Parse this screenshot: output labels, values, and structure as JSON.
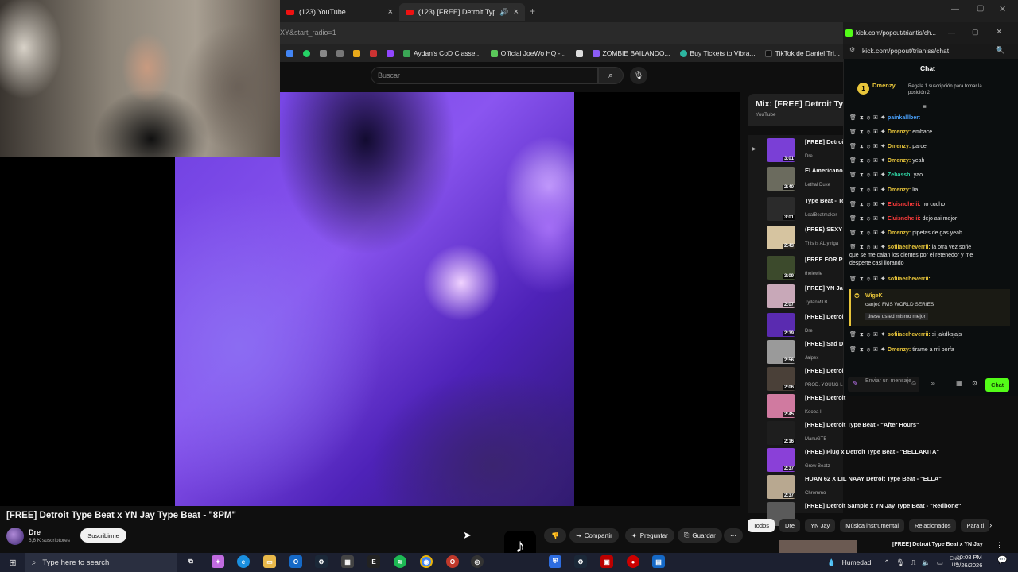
{
  "browser": {
    "tabs": [
      {
        "label": "(123) YouTube"
      },
      {
        "label": "(123) [FREE] Detroit Type Be"
      }
    ],
    "url_fragment": "XY&start_radio=1",
    "bookmarks": [
      {
        "label": "Aydan's CoD Classe...",
        "color": "#3aa655"
      },
      {
        "label": "Official JoeWo HQ -...",
        "color": "#5ac85a"
      },
      {
        "label": "ZOMBIE BAILANDO...",
        "color": "#8b5cf6"
      },
      {
        "label": "Buy Tickets to Vibra...",
        "color": "#2cb5a0"
      },
      {
        "label": "TikTok de Daniel Tri...",
        "color": "#111111"
      }
    ]
  },
  "youtube": {
    "search_placeholder": "Buscar",
    "video_title": "[FREE] Detroit Type Beat x YN Jay Type Beat - \"8PM\"",
    "channel_name": "Dre",
    "channel_subs": "6,6 K suscriptores",
    "subscribe_label": "Suscribirme",
    "actions": {
      "share": "Compartir",
      "ask": "Preguntar",
      "save": "Guardar"
    },
    "playlist": {
      "title": "Mix: [FREE] Detroit Type",
      "source": "YouTube",
      "items": [
        {
          "title": "[FREE] Detroit",
          "channel": "Dre",
          "duration": "3:01",
          "color": "#7a3fd6"
        },
        {
          "title": "El Americano x Trap Instrum",
          "channel": "Lethal Duke",
          "duration": "2:40",
          "color": "#6b6b5e"
        },
        {
          "title": "Type Beat - To 2025",
          "channel": "LealBeatmaker",
          "duration": "3:01",
          "color": "#2b2b2b"
        },
        {
          "title": "(FREE) SEXY D YOU\" - KIDWI",
          "channel": "This is AL y riga",
          "duration": "2:43",
          "color": "#d6c4a0"
        },
        {
          "title": "[FREE FOR PR BEAT 2026 –",
          "channel": "thelewie",
          "duration": "3:09",
          "color": "#3c4a2c"
        },
        {
          "title": "[FREE] YN Jay",
          "channel": "TyllanMTB",
          "duration": "2:07",
          "color": "#c8a8b8"
        },
        {
          "title": "[FREE] Detroit",
          "channel": "Dre",
          "duration": "2:39",
          "color": "#5a2bb0"
        },
        {
          "title": "[FREE] Sad De",
          "channel": "Jalpex",
          "duration": "2:56",
          "color": "#9a9a9a"
        },
        {
          "title": "[FREE] Detroit",
          "channel": "PROD. YOUNG L",
          "duration": "2:06",
          "color": "#4a4038"
        },
        {
          "title": "[FREE] Detroit",
          "channel": "Kooba II",
          "duration": "2:45",
          "color": "#d07aa0"
        },
        {
          "title": "[FREE] Detroit Type Beat - \"After Hours\"",
          "channel": "ManuGTB",
          "duration": "2:16",
          "color": "#1e1e1e"
        },
        {
          "title": "(FREE) Plug x Detroit Type Beat - \"BELLAKITA\"",
          "channel": "Grow Beatz",
          "duration": "2:37",
          "color": "#8a40d8"
        },
        {
          "title": "HUAN 62 X LIL NAAY Detroit Type Beat - \"ELLA\"",
          "channel": "Chrommo",
          "duration": "2:37",
          "color": "#b8a890"
        },
        {
          "title": "[FREE] Detroit Sample x YN Jay Type Beat - \"Redbone\"",
          "channel": "",
          "duration": "",
          "color": "#5a5a5a"
        }
      ]
    },
    "chips": [
      "Todos",
      "Dre",
      "YN Jay",
      "Música instrumental",
      "Relacionados",
      "Para ti"
    ],
    "next_up": "[FREE] Detroit Type Beat x YN Jay"
  },
  "kick": {
    "title": "kick.com/popout/triantis/ch...",
    "url": "kick.com/popout/trianiss/chat",
    "header": "Chat",
    "pinned_user": "Dmenzy",
    "pinned_text": "Regala 1 suscripción para tomar la posición 2",
    "messages": [
      {
        "user": "painkalllber",
        "text": "",
        "color": "#4aa3ff"
      },
      {
        "user": "Dmenzy",
        "text": "embace",
        "color": "#e8c53a"
      },
      {
        "user": "Dmenzy",
        "text": "parce",
        "color": "#e8c53a"
      },
      {
        "user": "Dmenzy",
        "text": "yeah",
        "color": "#e8c53a"
      },
      {
        "user": "Zebassh",
        "text": "yao",
        "color": "#2fd3a3"
      },
      {
        "user": "Dmenzy",
        "text": "lia",
        "color": "#e8c53a"
      },
      {
        "user": "Eluisnohelii",
        "text": "no cucho",
        "color": "#ff3b3b"
      },
      {
        "user": "Eluisnohelii",
        "text": "dejo asi mejor",
        "color": "#ff3b3b"
      },
      {
        "user": "Dmenzy",
        "text": "pipetas de gas yeah",
        "color": "#e8c53a"
      },
      {
        "user": "sofiiaecheverrii",
        "text": "la otra vez soñe",
        "color": "#e8c53a"
      },
      {
        "user": "",
        "text": "que se me caian los dientes por el retenedor y me",
        "color": "#e8c53a"
      },
      {
        "user": "",
        "text": "desperte casi llorando",
        "color": "#e8c53a"
      },
      {
        "user": "sofiiaecheverrii",
        "text": "",
        "color": "#e8c53a"
      }
    ],
    "redeem_user": "WigeK",
    "redeem_line": "canjeó FMS WORLD SERIES",
    "redeem_msg": "tirese usted mismo mejor",
    "messages2": [
      {
        "user": "sofiiaecheverrii",
        "text": "si jakdksjajs",
        "color": "#e8c53a"
      },
      {
        "user": "Dmenzy",
        "text": "tirame a mi porfa",
        "color": "#e8c53a"
      }
    ],
    "input_placeholder": "Enviar un mensaje",
    "send_label": "Chat"
  },
  "taskbar": {
    "search_placeholder": "Type here to search",
    "weather": "Humedad",
    "lang": "ENG",
    "region": "US",
    "time": "10:08 PM",
    "date": "2/26/2026"
  }
}
